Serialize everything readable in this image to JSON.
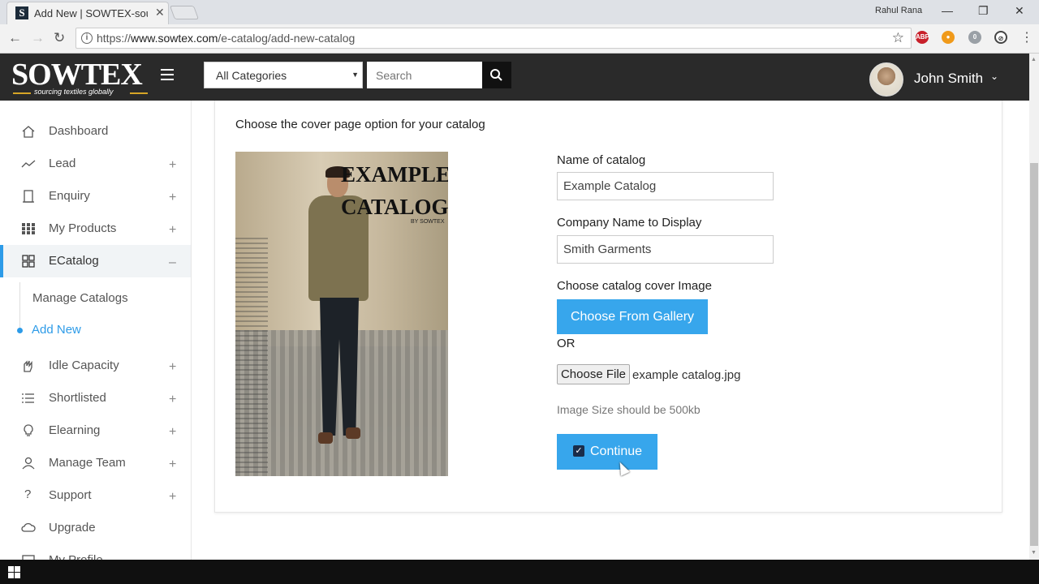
{
  "browser": {
    "tab_title": "Add New | SOWTEX-sour",
    "profile_name": "Rahul Rana",
    "url_prefix": "https://",
    "url_host": "www.sowtex.com",
    "url_path": "/e-catalog/add-new-catalog",
    "ext_badge": "0"
  },
  "header": {
    "logo": "SOWTEX",
    "tagline": "sourcing textiles globally",
    "category_selected": "All Categories",
    "search_placeholder": "Search",
    "user_name": "John Smith"
  },
  "sidebar": {
    "items": [
      {
        "label": "Dashboard",
        "icon": "home-icon",
        "expandable": false
      },
      {
        "label": "Lead",
        "icon": "trend-icon",
        "expandable": true
      },
      {
        "label": "Enquiry",
        "icon": "building-icon",
        "expandable": true
      },
      {
        "label": "My Products",
        "icon": "grid-icon",
        "expandable": true
      },
      {
        "label": "ECatalog",
        "icon": "catalog-icon",
        "expandable": true,
        "expanded": true
      },
      {
        "label": "Idle Capacity",
        "icon": "hand-icon",
        "expandable": true
      },
      {
        "label": "Shortlisted",
        "icon": "list-icon",
        "expandable": true
      },
      {
        "label": "Elearning",
        "icon": "bulb-icon",
        "expandable": true
      },
      {
        "label": "Manage Team",
        "icon": "user-icon",
        "expandable": true
      },
      {
        "label": "Support",
        "icon": "question-icon",
        "expandable": true
      },
      {
        "label": "Upgrade",
        "icon": "cloud-icon",
        "expandable": false
      },
      {
        "label": "My Profile",
        "icon": "profile-icon",
        "expandable": false
      }
    ],
    "plus": "+",
    "minus": "–",
    "subitems": [
      {
        "label": "Manage Catalogs"
      },
      {
        "label": "Add New",
        "current": true
      }
    ]
  },
  "main": {
    "title": "Choose the cover page option for your catalog",
    "cover": {
      "title_line1": "EXAMPLE",
      "title_line2": "CATALOG",
      "byline": "BY SOWTEX"
    },
    "form": {
      "name_label": "Name of catalog",
      "name_value": "Example Catalog",
      "company_label": "Company Name to Display",
      "company_value": "Smith Garments",
      "cover_label": "Choose catalog cover Image",
      "gallery_button": "Choose From Gallery",
      "or_text": "OR",
      "file_button": "Choose File",
      "file_name": "example catalog.jpg",
      "size_hint": "Image Size should be 500kb",
      "continue_button": "Continue"
    }
  },
  "colors": {
    "accent": "#37a6ec",
    "header_bg": "#2a2a2a",
    "active_border": "#2d9be8"
  }
}
